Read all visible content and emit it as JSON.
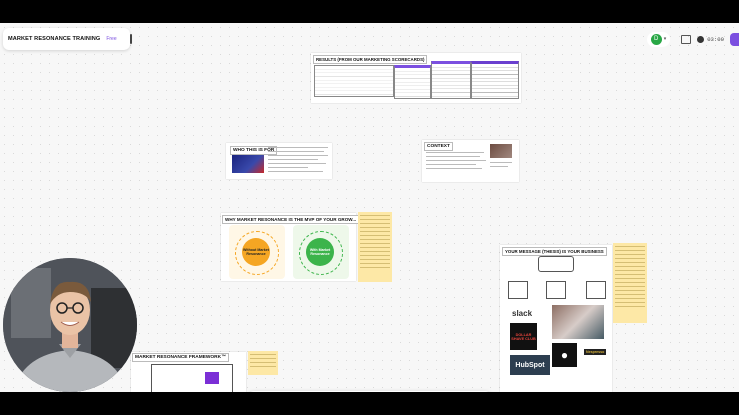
{
  "app": {
    "board_title": "MARKET RESONANCE TRAINING",
    "plan_badge": "Free",
    "avatar_initial": "D",
    "timer": "03:00"
  },
  "frames": {
    "results": {
      "title": "RESULTS (FROM OUR MARKETING SCORECARDS)"
    },
    "who": {
      "title": "WHO THIS IS FOR"
    },
    "context": {
      "title": "CONTEXT"
    },
    "mvp": {
      "title": "WHY MARKET RESONANCE IS THE MVP OF YOUR GROW...",
      "left_center": "Without Market Resonance",
      "right_center": "With Market Resonance"
    },
    "message": {
      "title": "YOUR MESSAGE (THESIS) IS YOUR BUSINESS",
      "logos": [
        "slack",
        "DOLLAR SHAVE CLUB",
        "HubSpot",
        "Nespresso"
      ]
    },
    "framework": {
      "title": "MARKET RESONANCE FRAMEWORK™"
    }
  },
  "toolbar": {
    "tools": [
      "select-tool",
      "hand-tool",
      "pen-tool",
      "highlighter-tool",
      "shape-tool",
      "connector-tool",
      "text-tool",
      "frame-tool",
      "table-tool",
      "people-tool",
      "comment-tool",
      "ai-tool",
      "add-tool"
    ]
  },
  "zoom": {
    "minus": "−",
    "plus": "+"
  },
  "colors": {
    "accent": "#7b4fe0",
    "sticky": "#fde8a6",
    "orange": "#f5a623",
    "green": "#3cb44b"
  }
}
